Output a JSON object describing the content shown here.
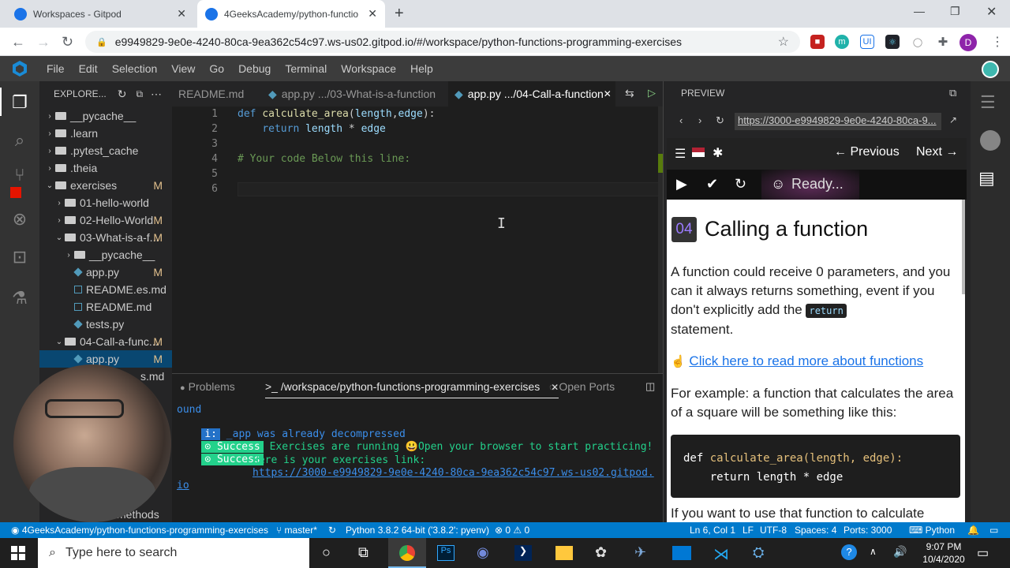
{
  "browser": {
    "tabs": [
      {
        "label": "Workspaces - Gitpod"
      },
      {
        "label": "4GeeksAcademy/python-functio"
      }
    ],
    "url": "e9949829-9e0e-4240-80ca-9ea362c54c97.ws-us02.gitpod.io/#/workspace/python-functions-programming-exercises",
    "profile_initial": "D"
  },
  "menu": [
    "File",
    "Edit",
    "Selection",
    "View",
    "Go",
    "Debug",
    "Terminal",
    "Workspace",
    "Help"
  ],
  "explorer": {
    "title": "EXPLORE...",
    "items": [
      {
        "label": "__pycache__",
        "type": "folder",
        "depth": 0,
        "expanded": false,
        "mark": ""
      },
      {
        "label": ".learn",
        "type": "folder",
        "depth": 0,
        "expanded": false,
        "mark": ""
      },
      {
        "label": ".pytest_cache",
        "type": "folder",
        "depth": 0,
        "expanded": false,
        "mark": ""
      },
      {
        "label": ".theia",
        "type": "folder",
        "depth": 0,
        "expanded": false,
        "mark": ""
      },
      {
        "label": "exercises",
        "type": "folder",
        "depth": 0,
        "expanded": true,
        "mark": "M"
      },
      {
        "label": "01-hello-world",
        "type": "folder",
        "depth": 1,
        "expanded": false,
        "mark": ""
      },
      {
        "label": "02-Hello-World",
        "type": "folder",
        "depth": 1,
        "expanded": false,
        "mark": "M"
      },
      {
        "label": "03-What-is-a-f...",
        "type": "folder",
        "depth": 1,
        "expanded": true,
        "mark": "M"
      },
      {
        "label": "__pycache__",
        "type": "folder",
        "depth": 2,
        "expanded": false,
        "mark": ""
      },
      {
        "label": "app.py",
        "type": "py",
        "depth": 2,
        "expanded": false,
        "mark": "M"
      },
      {
        "label": "README.es.md",
        "type": "md",
        "depth": 2,
        "expanded": false,
        "mark": ""
      },
      {
        "label": "README.md",
        "type": "md",
        "depth": 2,
        "expanded": false,
        "mark": ""
      },
      {
        "label": "tests.py",
        "type": "py",
        "depth": 2,
        "expanded": false,
        "mark": ""
      },
      {
        "label": "04-Call-a-func...",
        "type": "folder",
        "depth": 1,
        "expanded": true,
        "mark": "M"
      },
      {
        "label": "app.py",
        "type": "py",
        "depth": 2,
        "expanded": false,
        "mark": "M",
        "selected": true
      }
    ],
    "partial_md": "s.md",
    "partial_methods": "methods"
  },
  "editor_tabs": [
    {
      "label": "README.md"
    },
    {
      "label": "app.py .../03-What-is-a-function"
    },
    {
      "label": "app.py .../04-Call-a-function"
    }
  ],
  "code_lines": [
    {
      "n": "1",
      "text": "def calculate_area(length,edge):"
    },
    {
      "n": "2",
      "text": "    return length * edge"
    },
    {
      "n": "3",
      "text": ""
    },
    {
      "n": "4",
      "text": "# Your code Below this line:"
    },
    {
      "n": "5",
      "text": ""
    },
    {
      "n": "6",
      "text": ""
    }
  ],
  "panel": {
    "problems": "Problems",
    "terminal_tab": ">_ /workspace/python-functions-programming-exercises",
    "ports": "Open Ports",
    "lines": [
      "ound",
      "_app was already decompressed",
      "Exercises are running 😃Open your browser to start practicing!",
      "Here is your exercises link:",
      "https://3000-e9949829-9e0e-4240-80ca-9ea362c54c97.ws-us02.gitpod.",
      "io"
    ],
    "info_badge": "i:",
    "success_badge": "⊙ Success"
  },
  "preview": {
    "title": "PREVIEW",
    "url": "https://3000-e9949829-9e0e-4240-80ca-9...",
    "prev": "Previous",
    "next": "Next",
    "status": "Ready...",
    "number": "04",
    "heading": "Calling a function",
    "para1_a": "A function could receive 0 parameters, and you can it always returns something, event if you don't explicitly add the ",
    "para1_code": "return",
    "para1_b": "statement.",
    "link": "Click here to read more about functions",
    "para2": "For example: a function that calculates the area of a square will be something like this:",
    "code1": "def calculate_area(length, edge):",
    "code2": "    return length * edge",
    "para3": "If you want to use that function to calculate"
  },
  "status": {
    "repo": "4GeeksAcademy/python-functions-programming-exercises",
    "branch": "master*",
    "python": "Python 3.8.2 64-bit ('3.8.2': pyenv)",
    "errors": "0",
    "warnings": "0",
    "position": "Ln 6, Col 1",
    "eol": "LF",
    "encoding": "UTF-8",
    "spaces": "Spaces: 4",
    "ports": "Ports: 3000",
    "lang": "Python"
  },
  "taskbar": {
    "search": "Type here to search",
    "time": "9:07 PM",
    "date": "10/4/2020"
  },
  "colors": {
    "accent": "#007acc",
    "selection": "#094771",
    "success": "#23d18b",
    "link": "#3b8eea"
  }
}
